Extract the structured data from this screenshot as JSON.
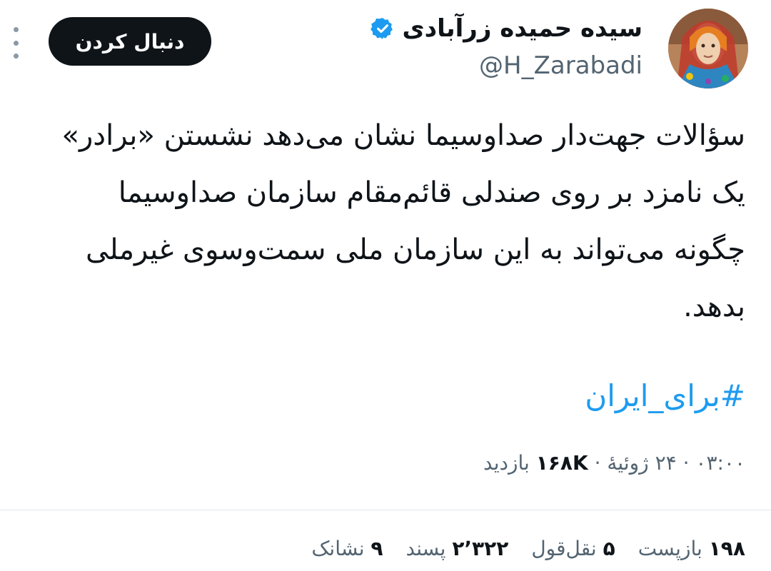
{
  "author": {
    "display_name": "سیده حمیده زرآبادی",
    "handle": "@H_Zarabadi",
    "verified": true,
    "avatar_icon": "profile-photo"
  },
  "follow_button": {
    "label": "دنبال کردن"
  },
  "more_icon": "more-vertical-icon",
  "tweet": {
    "lines": [
      "سؤالات جهت‌دار صداوسیما نشان می‌دهد نشستن «برادر»",
      "یک نامزد بر روی صندلی قائم‌مقام سازمان صداوسیما",
      "چگونه می‌تواند به این سازمان ملی سمت‌وسوی غیرملی",
      "بدهد."
    ],
    "hashtag": "#برای_ایران"
  },
  "meta": {
    "time": "۰۳:۰۰",
    "date": "۲۴ ژوئیهٔ",
    "views_count": "۱۶۸K",
    "views_label": "بازدید"
  },
  "stats": {
    "reposts": {
      "count": "۱۹۸",
      "label": "بازپست"
    },
    "quotes": {
      "count": "۵",
      "label": "نقل‌قول"
    },
    "likes": {
      "count": "۲٬۳۲۲",
      "label": "پسند"
    },
    "bookmarks": {
      "count": "۹",
      "label": "نشانک"
    }
  },
  "colors": {
    "link": "#1d9bf0",
    "text": "#0f1419",
    "muted": "#536471",
    "button_bg": "#0f1419"
  }
}
